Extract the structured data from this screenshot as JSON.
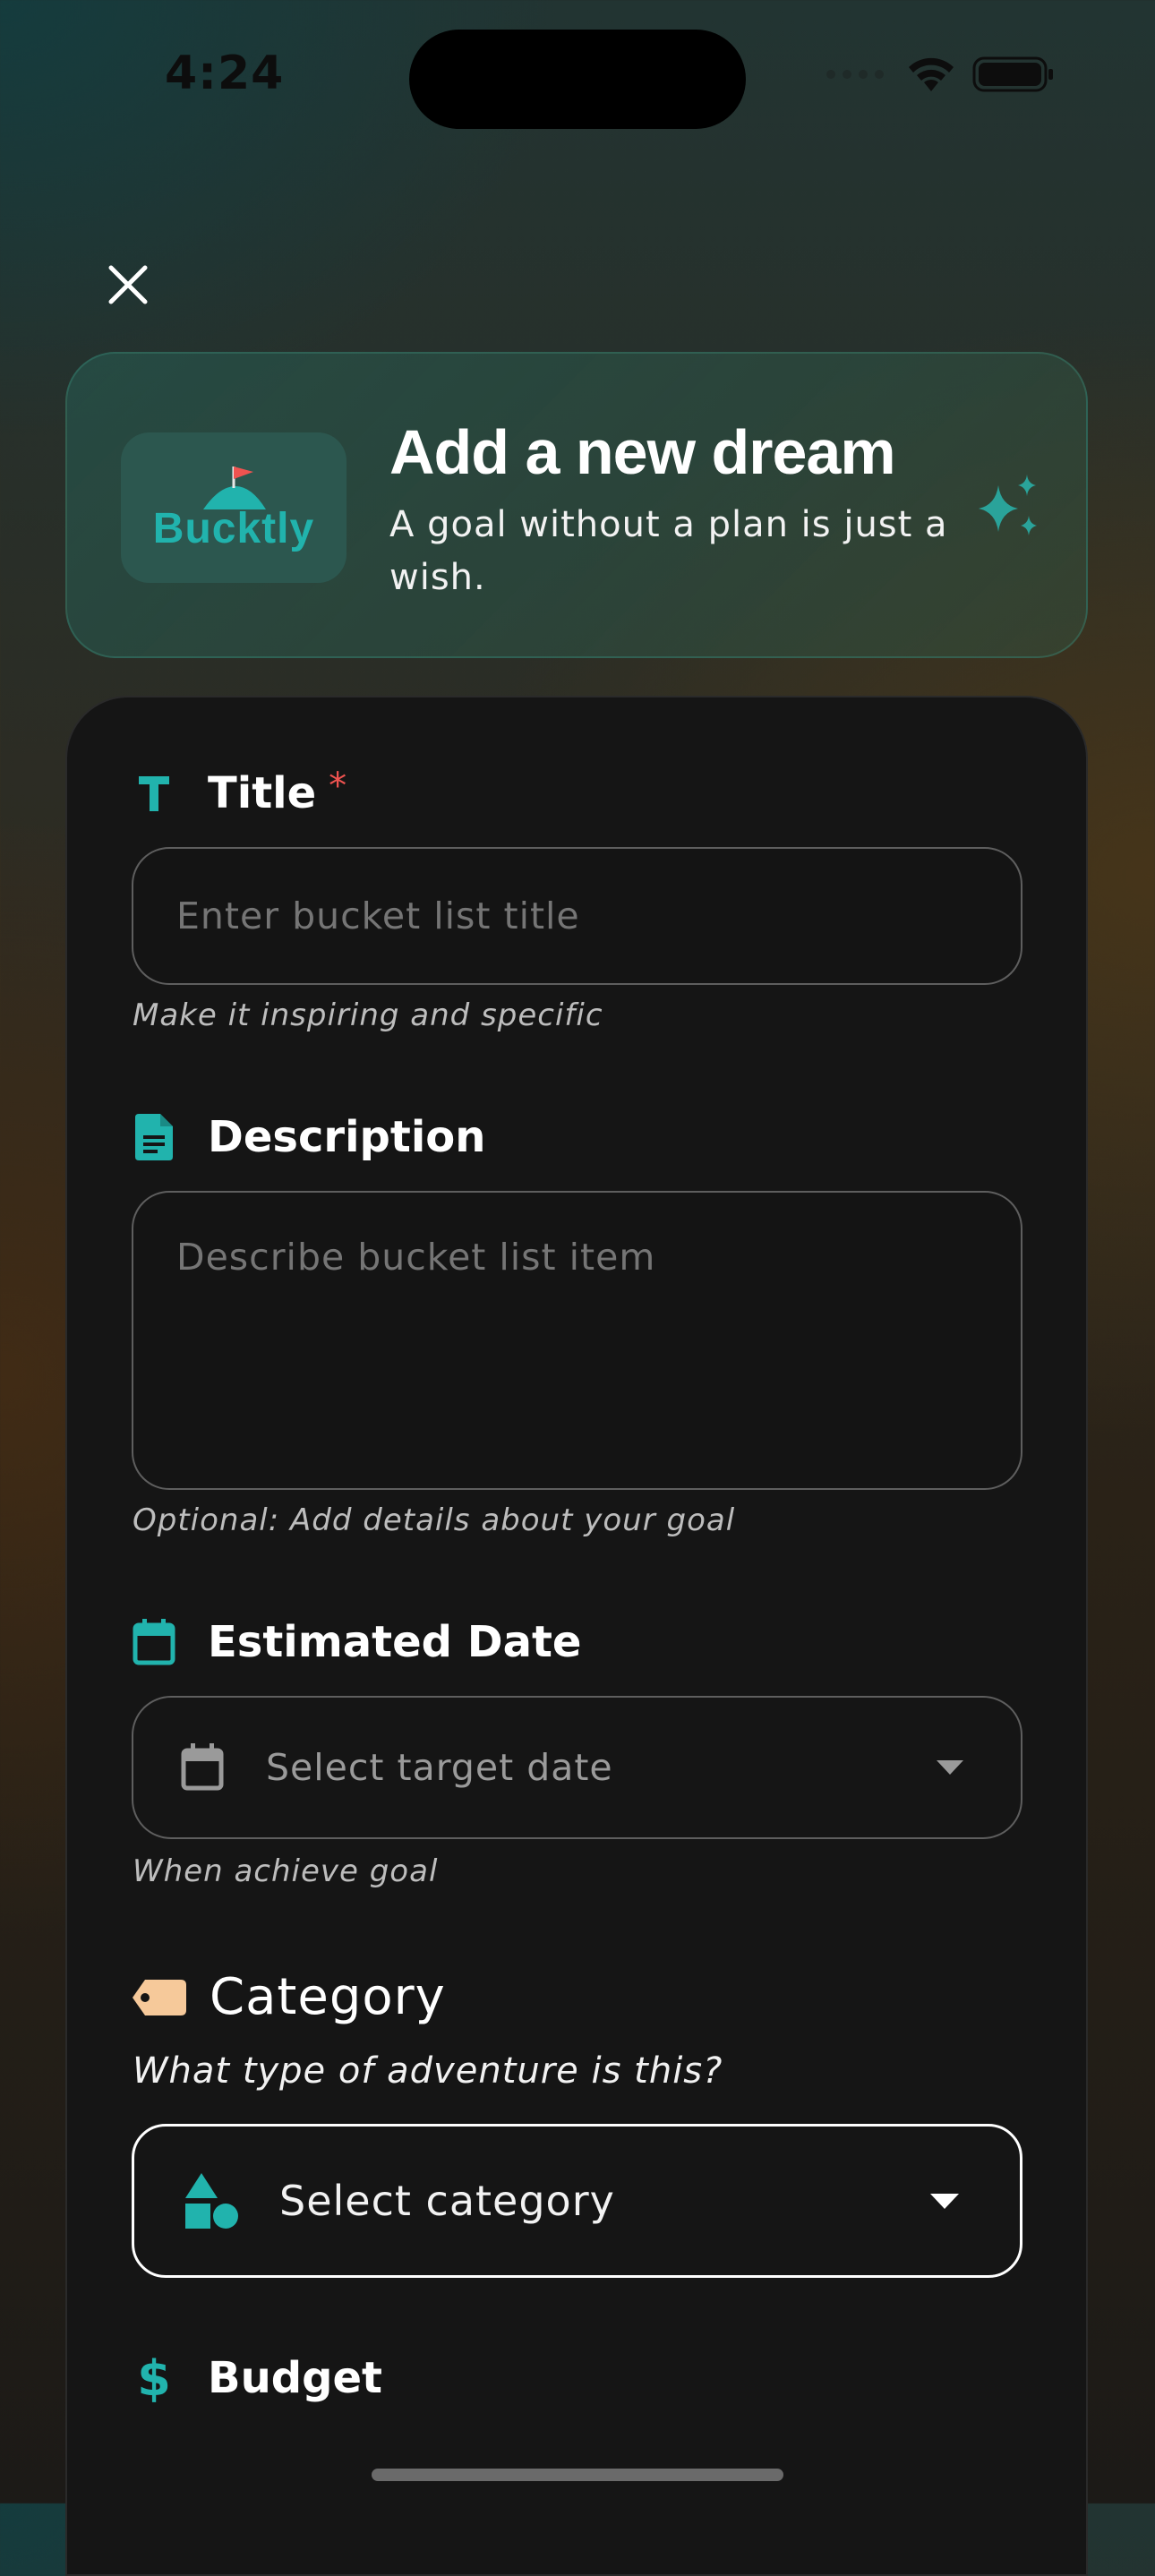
{
  "status_bar": {
    "time": "4:24"
  },
  "header": {
    "logo_text": "Bucktly",
    "title": "Add a new dream",
    "subtitle": "A goal without a plan is just a wish."
  },
  "form": {
    "title": {
      "label": "Title",
      "required_mark": "*",
      "placeholder": "Enter bucket list title",
      "value": "",
      "helper": "Make it inspiring and specific"
    },
    "description": {
      "label": "Description",
      "placeholder": "Describe bucket list item",
      "value": "",
      "helper": "Optional: Add details about your goal"
    },
    "estimated_date": {
      "label": "Estimated Date",
      "placeholder": "Select target date",
      "helper": "When achieve goal"
    },
    "category": {
      "label": "Category",
      "subtitle": "What type of adventure is this?",
      "placeholder": "Select category"
    },
    "budget": {
      "label": "Budget"
    }
  },
  "colors": {
    "accent": "#21b3ad",
    "required": "#ef5350",
    "tag": "#f6c99a",
    "card": "#151515"
  },
  "icons": {
    "close": "close-icon",
    "title": "text-icon",
    "description": "document-icon",
    "date": "calendar-icon",
    "category": "tag-icon",
    "category_field": "shapes-icon",
    "budget": "dollar-icon",
    "sparkle": "sparkle-icon"
  }
}
